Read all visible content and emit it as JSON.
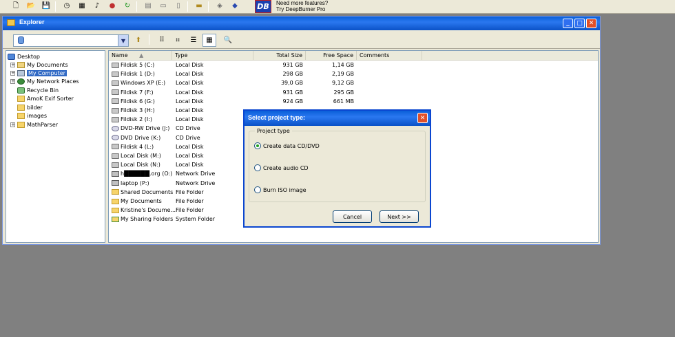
{
  "toolbar": {
    "icons": [
      "new-icon",
      "open-icon",
      "save-icon",
      "clock-icon",
      "calendar-icon",
      "music-icon",
      "burn-icon",
      "refresh-icon",
      "layout-icon-1",
      "layout-icon-2",
      "layout-icon-3",
      "folder-icon",
      "eraser-icon",
      "info-icon"
    ]
  },
  "promo": {
    "logo": "DB",
    "line1": "Need more features?",
    "line2": "Try DeepBurner Pro"
  },
  "explorer": {
    "title": "Explorer",
    "controls": {
      "minimize": "_",
      "maximize": "□",
      "close": "✕"
    }
  },
  "tree": {
    "items": [
      {
        "label": "Desktop",
        "icon": "desktop-icon"
      },
      {
        "label": "My Documents",
        "icon": "my-documents-icon"
      },
      {
        "label": "My Computer",
        "icon": "computer-icon"
      },
      {
        "label": "My Network Places",
        "icon": "network-icon"
      },
      {
        "label": "Recycle Bin",
        "icon": "recycle-bin-icon"
      },
      {
        "label": "AmoK Exif Sorter",
        "icon": "folder-icon"
      },
      {
        "label": "bilder",
        "icon": "folder-icon"
      },
      {
        "label": "images",
        "icon": "folder-icon"
      },
      {
        "label": "MathParser",
        "icon": "folder-icon"
      }
    ]
  },
  "list": {
    "headers": {
      "name": "Name",
      "type": "Type",
      "total": "Total Size",
      "free": "Free Space",
      "comments": "Comments"
    },
    "rows": [
      {
        "name": "Fildisk 5 (C:)",
        "type": "Local Disk",
        "total": "931 GB",
        "free": "1,14 GB"
      },
      {
        "name": "Fildisk 1 (D:)",
        "type": "Local Disk",
        "total": "298 GB",
        "free": "2,19 GB"
      },
      {
        "name": "Windows XP (E:)",
        "type": "Local Disk",
        "total": "39,0 GB",
        "free": "9,12 GB"
      },
      {
        "name": "Fildisk 7 (F:)",
        "type": "Local Disk",
        "total": "931 GB",
        "free": "295 GB"
      },
      {
        "name": "Fildisk 6 (G:)",
        "type": "Local Disk",
        "total": "924 GB",
        "free": "661 MB"
      },
      {
        "name": "Fildisk 3 (H:)",
        "type": "Local Disk",
        "total": "",
        "free": ""
      },
      {
        "name": "Fildisk 2 (I:)",
        "type": "Local Disk",
        "total": "",
        "free": ""
      },
      {
        "name": "DVD-RW Drive (J:)",
        "type": "CD Drive",
        "total": "",
        "free": ""
      },
      {
        "name": "DVD Drive (K:)",
        "type": "CD Drive",
        "total": "",
        "free": ""
      },
      {
        "name": "Fildisk 4 (L:)",
        "type": "Local Disk",
        "total": "",
        "free": ""
      },
      {
        "name": "Local Disk (M:)",
        "type": "Local Disk",
        "total": "",
        "free": ""
      },
      {
        "name": "Local Disk (N:)",
        "type": "Local Disk",
        "total": "",
        "free": ""
      },
      {
        "name": "h██████.org (O:)",
        "type": "Network Drive",
        "total": "",
        "free": ""
      },
      {
        "name": "laptop (P:)",
        "type": "Network Drive",
        "total": "",
        "free": ""
      },
      {
        "name": "Shared Documents",
        "type": "File Folder",
        "total": "",
        "free": ""
      },
      {
        "name": "My Documents",
        "type": "File Folder",
        "total": "",
        "free": ""
      },
      {
        "name": "Kristine's Docume...",
        "type": "File Folder",
        "total": "",
        "free": ""
      },
      {
        "name": "My Sharing Folders",
        "type": "System Folder",
        "total": "",
        "free": ""
      }
    ]
  },
  "dialog": {
    "title": "Select project type:",
    "group_label": "Project type",
    "options": [
      {
        "label": "Create data CD/DVD",
        "selected": true
      },
      {
        "label": "Create audio CD",
        "selected": false
      },
      {
        "label": "Burn ISO image",
        "selected": false
      }
    ],
    "cancel": "Cancel",
    "next": "Next >>"
  }
}
